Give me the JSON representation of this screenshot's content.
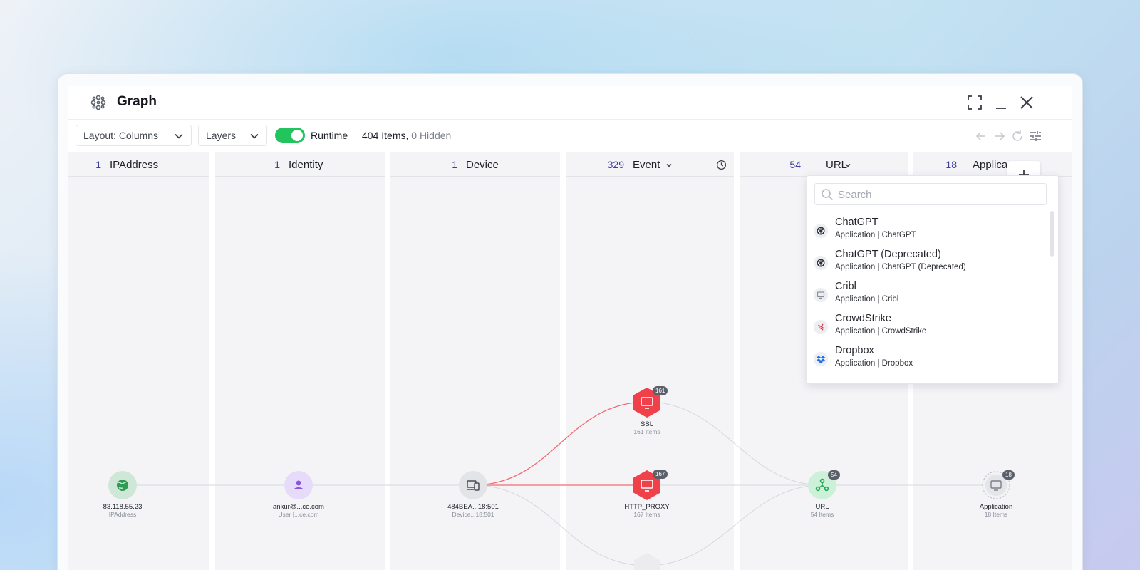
{
  "window": {
    "title": "Graph",
    "icons": [
      "grip-icon",
      "graph-app-icon",
      "fullscreen-icon",
      "minimize-icon",
      "close-icon"
    ]
  },
  "toolbar": {
    "layout_label": "Layout: Columns",
    "layers_label": "Layers",
    "runtime_label": "Runtime",
    "runtime_enabled": true,
    "items_count": "404 Items,",
    "hidden_count": "0 Hidden",
    "icons": [
      "back-arrow-icon",
      "forward-arrow-icon",
      "refresh-icon",
      "filter-settings-icon"
    ]
  },
  "columns": [
    {
      "count": "1",
      "label": "IPAddress"
    },
    {
      "count": "1",
      "label": "Identity"
    },
    {
      "count": "1",
      "label": "Device"
    },
    {
      "count": "329",
      "label": "Event"
    },
    {
      "count": "54",
      "label": "URL"
    },
    {
      "count": "18",
      "label": "Applica"
    }
  ],
  "nodes": [
    {
      "label": "83.118.55.23",
      "sub": "IPAddress"
    },
    {
      "label": "ankur@...ce.com",
      "sub": "User |...ce.com"
    },
    {
      "label": "484BEA...18:501",
      "sub": "Device...18:501"
    },
    {
      "label": "SSL",
      "sub": "161 Items",
      "badge": "161"
    },
    {
      "label": "HTTP_PROXY",
      "sub": "167 Items",
      "badge": "167"
    },
    {
      "label": "URL",
      "sub": "54 Items",
      "badge": "54"
    },
    {
      "label": "Application",
      "sub": "18 Items",
      "badge": "18"
    }
  ],
  "search": {
    "placeholder": "Search",
    "value": "",
    "items": [
      {
        "name": "ChatGPT",
        "sub": "Application | ChatGPT",
        "icon": "chatgpt-icon"
      },
      {
        "name": "ChatGPT (Deprecated)",
        "sub": "Application | ChatGPT (Deprecated)",
        "icon": "chatgpt-icon"
      },
      {
        "name": "Cribl",
        "sub": "Application | Cribl",
        "icon": "monitor-icon"
      },
      {
        "name": "CrowdStrike",
        "sub": "Application | CrowdStrike",
        "icon": "crowdstrike-icon"
      },
      {
        "name": "Dropbox",
        "sub": "Application | Dropbox",
        "icon": "dropbox-icon"
      }
    ]
  },
  "colors": {
    "accent_green": "#22c45e",
    "event_red": "#f0404a",
    "count_blue": "#3d3f9a"
  }
}
